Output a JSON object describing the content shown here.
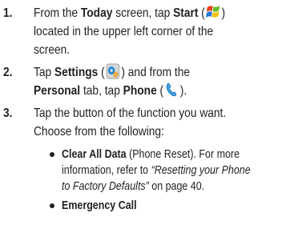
{
  "steps": [
    {
      "number": "1.",
      "line1_pre": "From the ",
      "line1_bold": "Today",
      "line1_mid": " screen, tap ",
      "line1_bold2": "Start",
      "line1_open": " (",
      "line1_close": ")",
      "line2": "located in the upper left corner of the",
      "line3": "screen.",
      "icon": "windows-start-flag-icon"
    },
    {
      "number": "2.",
      "line1_pre": "Tap ",
      "line1_bold": "Settings",
      "line1_open": " (",
      "line1_close": ") and from the",
      "line2_bold": "Personal",
      "line2_mid": " tab, tap ",
      "line2_bold2": "Phone",
      "line2_open": " (",
      "line2_close": ").",
      "icon_settings": "settings-gears-icon",
      "icon_phone": "phone-handset-icon"
    },
    {
      "number": "3.",
      "line1": "Tap the button of the function you want.",
      "line2": "Choose from the following:"
    }
  ],
  "bullets": [
    {
      "bold": "Clear All Data",
      "line1_rest": " (Phone Reset). For more",
      "line2": "information, refer to ",
      "line2_italic": "“Resetting your Phone",
      "line3_italic": "to Factory Defaults”",
      "line3_rest": " on page 40."
    },
    {
      "bold": "Emergency Call"
    }
  ]
}
